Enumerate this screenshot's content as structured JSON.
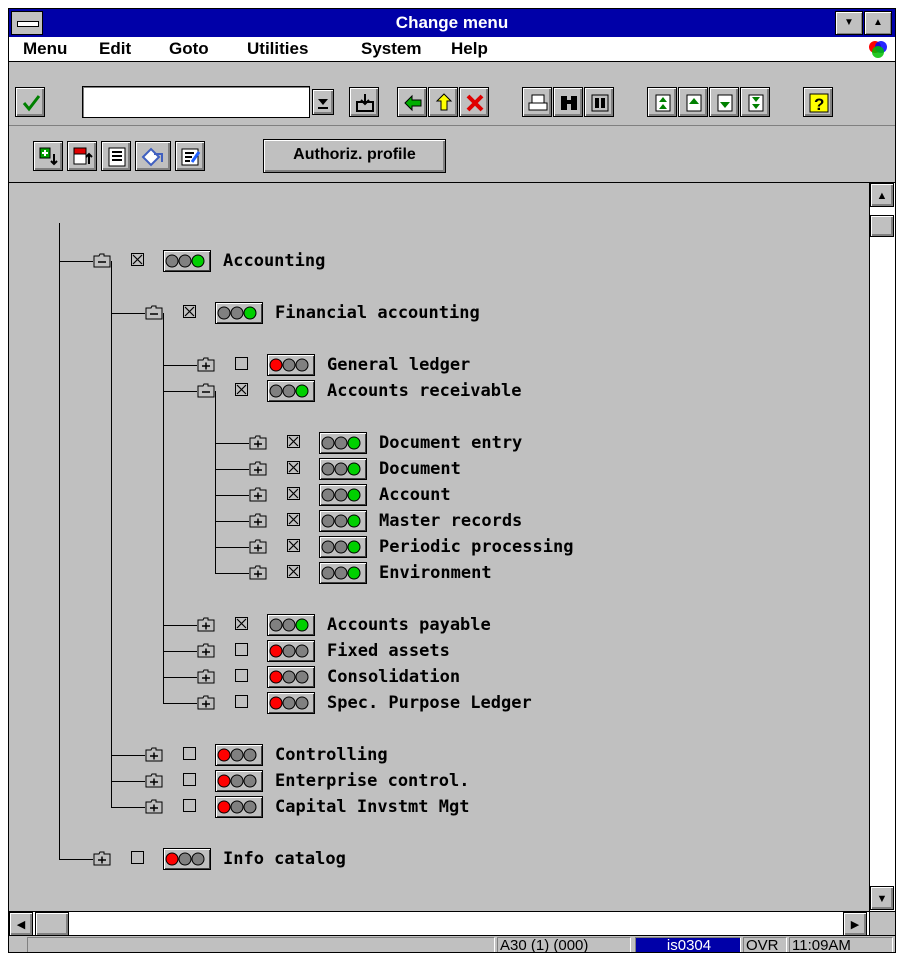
{
  "window": {
    "title": "Change menu"
  },
  "menubar": {
    "items": [
      {
        "label": "Menu"
      },
      {
        "label": "Edit"
      },
      {
        "label": "Goto"
      },
      {
        "label": "Utilities"
      },
      {
        "label": "System"
      },
      {
        "label": "Help"
      }
    ]
  },
  "toolbar": {
    "command_field_value": "",
    "icons": [
      "enter-check-icon",
      "dropdown-icon",
      "save-icon",
      "back-arrow-icon",
      "exit-up-icon",
      "cancel-x-icon",
      "print-icon",
      "find-icon",
      "find-next-icon",
      "first-page-icon",
      "previous-page-icon",
      "next-page-icon",
      "last-page-icon",
      "help-icon"
    ]
  },
  "app_toolbar": {
    "authoriz_label": "Authoriz. profile",
    "icons": [
      "expand-subtree-icon",
      "collapse-subtree-icon",
      "display-list-icon",
      "refresh-icon",
      "edit-icon"
    ]
  },
  "tree": {
    "nodes": [
      {
        "label": "Accounting",
        "checked": true,
        "status": "green"
      },
      {
        "label": "Financial accounting",
        "checked": true,
        "status": "green"
      },
      {
        "label": "General ledger",
        "checked": false,
        "status": "red"
      },
      {
        "label": "Accounts receivable",
        "checked": true,
        "status": "green"
      },
      {
        "label": "Document entry",
        "checked": true,
        "status": "green"
      },
      {
        "label": "Document",
        "checked": true,
        "status": "green"
      },
      {
        "label": "Account",
        "checked": true,
        "status": "green"
      },
      {
        "label": "Master records",
        "checked": true,
        "status": "green"
      },
      {
        "label": "Periodic processing",
        "checked": true,
        "status": "green"
      },
      {
        "label": "Environment",
        "checked": true,
        "status": "green"
      },
      {
        "label": "Accounts payable",
        "checked": true,
        "status": "green"
      },
      {
        "label": "Fixed assets",
        "checked": false,
        "status": "red"
      },
      {
        "label": "Consolidation",
        "checked": false,
        "status": "red"
      },
      {
        "label": "Spec. Purpose Ledger",
        "checked": false,
        "status": "red"
      },
      {
        "label": "Controlling",
        "checked": false,
        "status": "red"
      },
      {
        "label": "Enterprise control.",
        "checked": false,
        "status": "red"
      },
      {
        "label": "Capital Invstmt Mgt",
        "checked": false,
        "status": "red"
      },
      {
        "label": "Info catalog",
        "checked": false,
        "status": "red"
      }
    ]
  },
  "statusbar": {
    "message": "",
    "system": "A30 (1) (000)",
    "server": "is0304",
    "mode": "OVR",
    "time": "11:09AM"
  },
  "colors": {
    "titlebar": "#0000a8",
    "window_bg": "#c0c0c0",
    "light_red": "#ff0000",
    "light_green": "#00d000",
    "light_off": "#808080"
  }
}
